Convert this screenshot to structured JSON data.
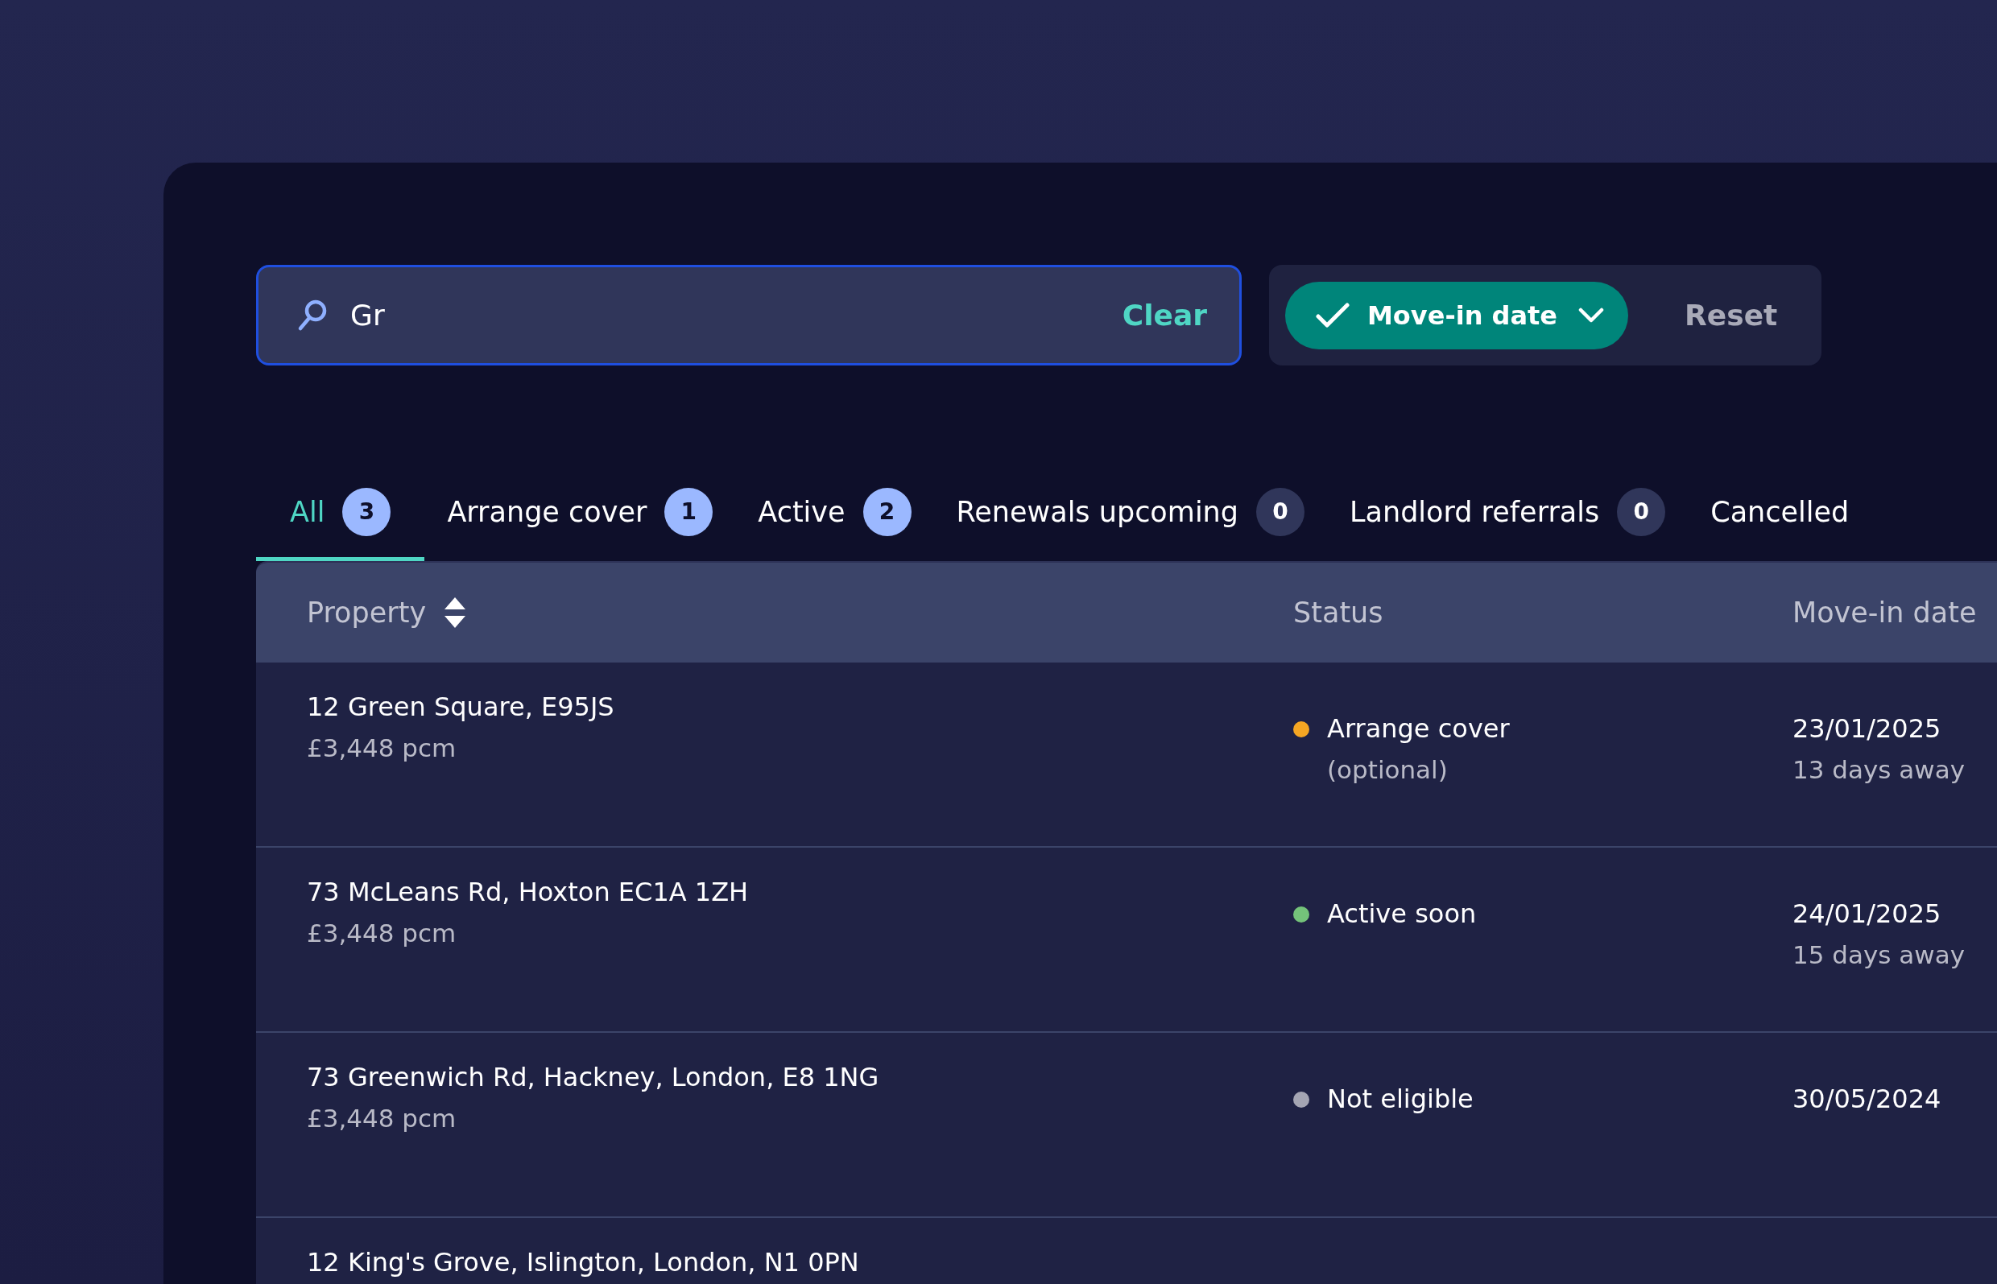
{
  "search": {
    "value": "Gr",
    "clear_label": "Clear"
  },
  "filters": {
    "chip": {
      "label": "Move-in date",
      "checked": true
    },
    "reset_label": "Reset"
  },
  "tabs": [
    {
      "label": "All",
      "count": "3",
      "badge_highlighted": true,
      "selected": true
    },
    {
      "label": "Arrange cover",
      "count": "1",
      "badge_highlighted": true,
      "selected": false
    },
    {
      "label": "Active",
      "count": "2",
      "badge_highlighted": true,
      "selected": false
    },
    {
      "label": "Renewals upcoming",
      "count": "0",
      "badge_highlighted": false,
      "selected": false
    },
    {
      "label": "Landlord referrals",
      "count": "0",
      "badge_highlighted": false,
      "selected": false
    },
    {
      "label": "Cancelled",
      "selected": false
    }
  ],
  "table": {
    "columns": [
      "Property",
      "Status",
      "Move-in date"
    ],
    "rows": [
      {
        "property": "12 Green Square, E95JS",
        "price": "£3,448 pcm",
        "status": "Arrange cover",
        "status_note": "(optional)",
        "color": "#f5a623",
        "date": "23/01/2025",
        "date_note": "13 days away"
      },
      {
        "property": "73 McLeans Rd, Hoxton EC1A 1ZH",
        "price": "£3,448 pcm",
        "status": "Active soon",
        "color": "#74c37a",
        "date": "24/01/2025",
        "date_note": "15 days away"
      },
      {
        "property": "73 Greenwich Rd, Hackney, London, E8 1NG",
        "price": "£3,448 pcm",
        "status": "Not eligible",
        "color": "#a4a5b3",
        "date": "30/05/2024"
      },
      {
        "property": "12 King's Grove, Islington, London, N1 0PN"
      }
    ]
  }
}
